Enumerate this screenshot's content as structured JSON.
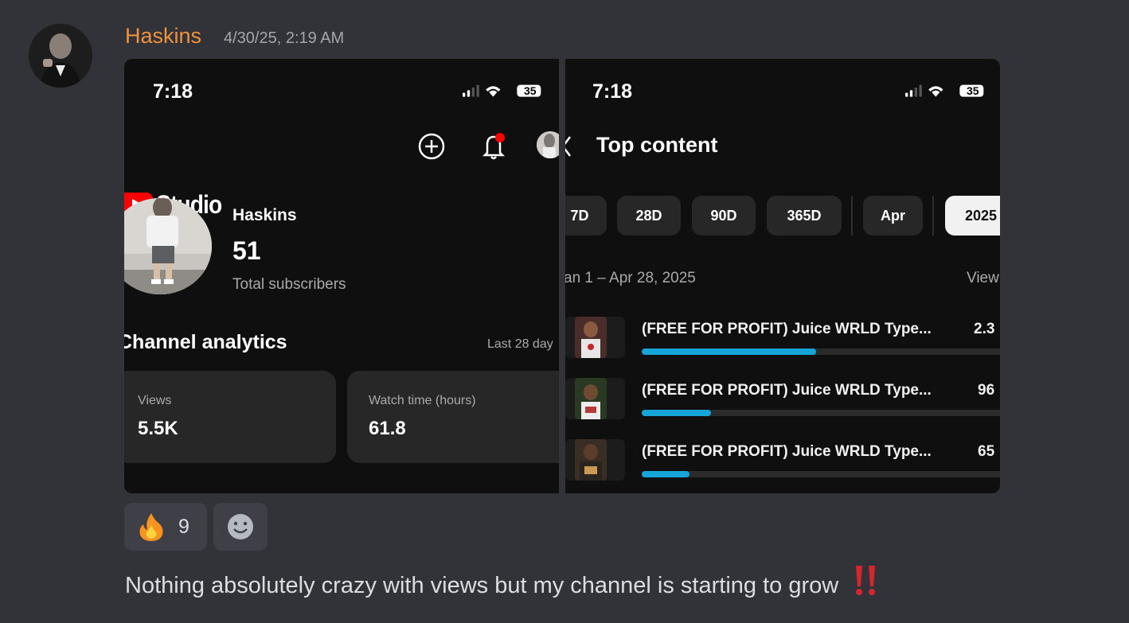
{
  "post": {
    "author": "Haskins",
    "timestamp": "4/30/25, 2:19 AM",
    "author_color": "#f0913b",
    "message": "Nothing absolutely crazy with views but my channel is starting to grow",
    "message_emoji": "double-exclamation-icon"
  },
  "left_screen": {
    "time": "7:18",
    "battery": "35",
    "app_name": "Studio",
    "channel_name": "Haskins",
    "subscribers": "51",
    "subscribers_label": "Total subscribers",
    "analytics_title": "Channel analytics",
    "analytics_period": "Last 28 day",
    "cards": [
      {
        "label": "Views",
        "value": "5.5K"
      },
      {
        "label": "Watch time (hours)",
        "value": "61.8"
      }
    ]
  },
  "right_screen": {
    "time": "7:18",
    "battery": "35",
    "title": "Top content",
    "filters": [
      "7D",
      "28D",
      "90D",
      "365D",
      "Apr",
      "2025"
    ],
    "active_filter": "2025",
    "date_range": "an 1 – Apr 28, 2025",
    "views_header": "View",
    "accent_color": "#16a5d8",
    "videos": [
      {
        "title": "(FREE FOR PROFIT) Juice WRLD Type...",
        "views": "2.3",
        "bar_fraction": 0.475
      },
      {
        "title": "(FREE FOR PROFIT) Juice WRLD Type...",
        "views": "96",
        "bar_fraction": 0.19
      },
      {
        "title": "(FREE FOR PROFIT) Juice WRLD Type...",
        "views": "65",
        "bar_fraction": 0.13
      }
    ]
  },
  "reactions": [
    {
      "emoji": "fire-icon",
      "count": "9"
    },
    {
      "emoji": "add-reaction-icon"
    }
  ]
}
